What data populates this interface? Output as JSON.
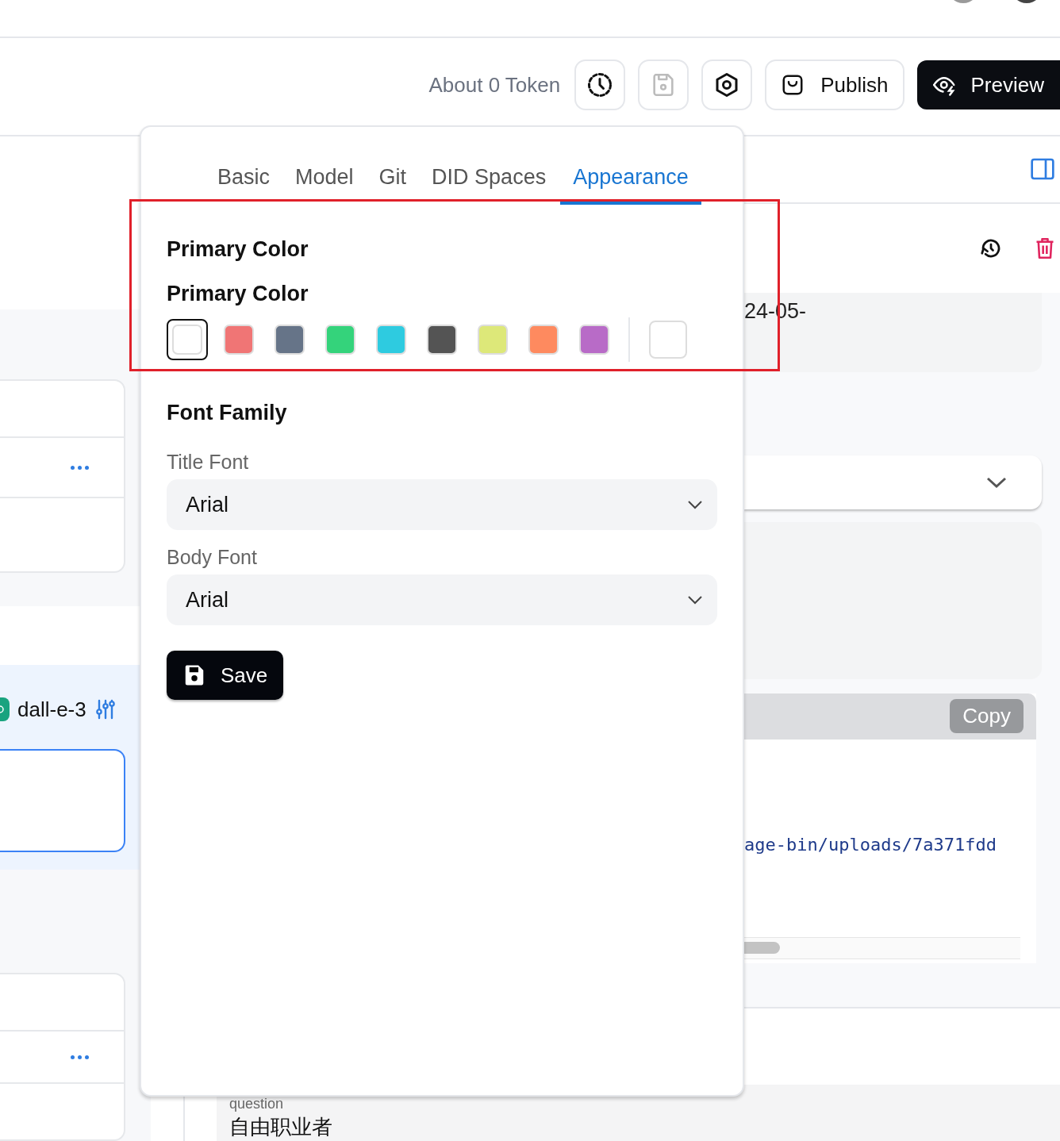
{
  "toolbar": {
    "token_label": "About 0 Token",
    "icon_buttons": [
      {
        "kind": "history",
        "disabled": false
      },
      {
        "kind": "save",
        "disabled": true
      },
      {
        "kind": "settings",
        "disabled": false
      }
    ],
    "publish_button": "Publish",
    "preview_button": "Preview"
  },
  "settings_popover": {
    "tabs": [
      {
        "label": "Basic",
        "selected": false
      },
      {
        "label": "Model",
        "selected": false
      },
      {
        "label": "Git",
        "selected": false
      },
      {
        "label": "DID Spaces",
        "selected": false
      },
      {
        "label": "Appearance",
        "selected": true
      }
    ],
    "primary_color": {
      "heading": "Primary Color",
      "label": "Primary Color",
      "swatches": [
        {
          "color": "#ffffff",
          "selected": true
        },
        {
          "color": "#f07575",
          "selected": false
        },
        {
          "color": "#667488",
          "selected": false
        },
        {
          "color": "#34d37b",
          "selected": false
        },
        {
          "color": "#2ecbe0",
          "selected": false
        },
        {
          "color": "#545454",
          "selected": false
        },
        {
          "color": "#dde879",
          "selected": false
        },
        {
          "color": "#fe8a5f",
          "selected": false
        },
        {
          "color": "#b86bc7",
          "selected": false
        }
      ]
    },
    "font_family": {
      "heading": "Font Family",
      "fields": [
        {
          "label": "Title Font",
          "value": "Arial"
        },
        {
          "label": "Body Font",
          "value": "Arial"
        }
      ]
    },
    "save_button": "Save"
  },
  "left_panel": {
    "model_name": "dall-e-3"
  },
  "right_panel": {
    "date_text": "24-05-",
    "copy_button": "Copy",
    "code_text": "age-bin/uploads/7a371fdd"
  },
  "bottom_field": {
    "label": "question",
    "value": "自由职业者"
  }
}
